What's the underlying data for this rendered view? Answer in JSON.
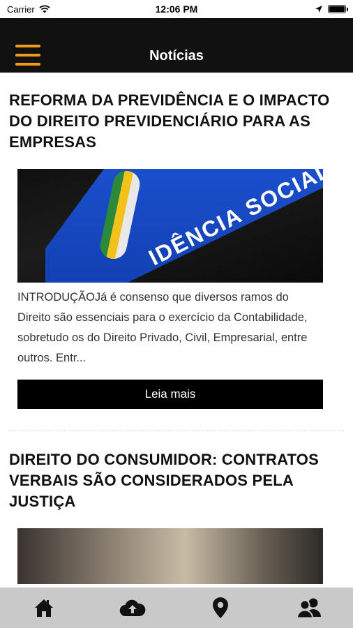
{
  "status_bar": {
    "carrier": "Carrier",
    "time": "12:06 PM",
    "battery_level": 1.0
  },
  "nav": {
    "title": "Notícias",
    "menu_icon": "hamburger-menu-icon",
    "accent_color": "#f29a1c",
    "background_color": "#111111"
  },
  "articles": [
    {
      "title": "REFORMA DA PREVIDÊNCIA E O IMPACTO DO DIREITO PREVIDENCIÁRIO PARA AS EMPRESAS",
      "image_text": "IDÊNCIA SOCIAL",
      "excerpt": "INTRODUÇÃOJá é consenso que diversos ramos do Direito são essenciais para o exercício da Contabilidade, sobretudo os do Direito Privado, Civil, Empresarial, entre outros. Entr...",
      "button_label": "Leia mais"
    },
    {
      "title": "DIREITO DO CONSUMIDOR: CONTRATOS VERBAIS SÃO CONSIDERADOS PELA JUSTIÇA"
    }
  ],
  "tab_bar": {
    "background_color": "#c9c9c9",
    "tabs": [
      {
        "icon": "home-icon"
      },
      {
        "icon": "cloud-upload-icon"
      },
      {
        "icon": "location-pin-icon"
      },
      {
        "icon": "contacts-icon"
      }
    ]
  }
}
